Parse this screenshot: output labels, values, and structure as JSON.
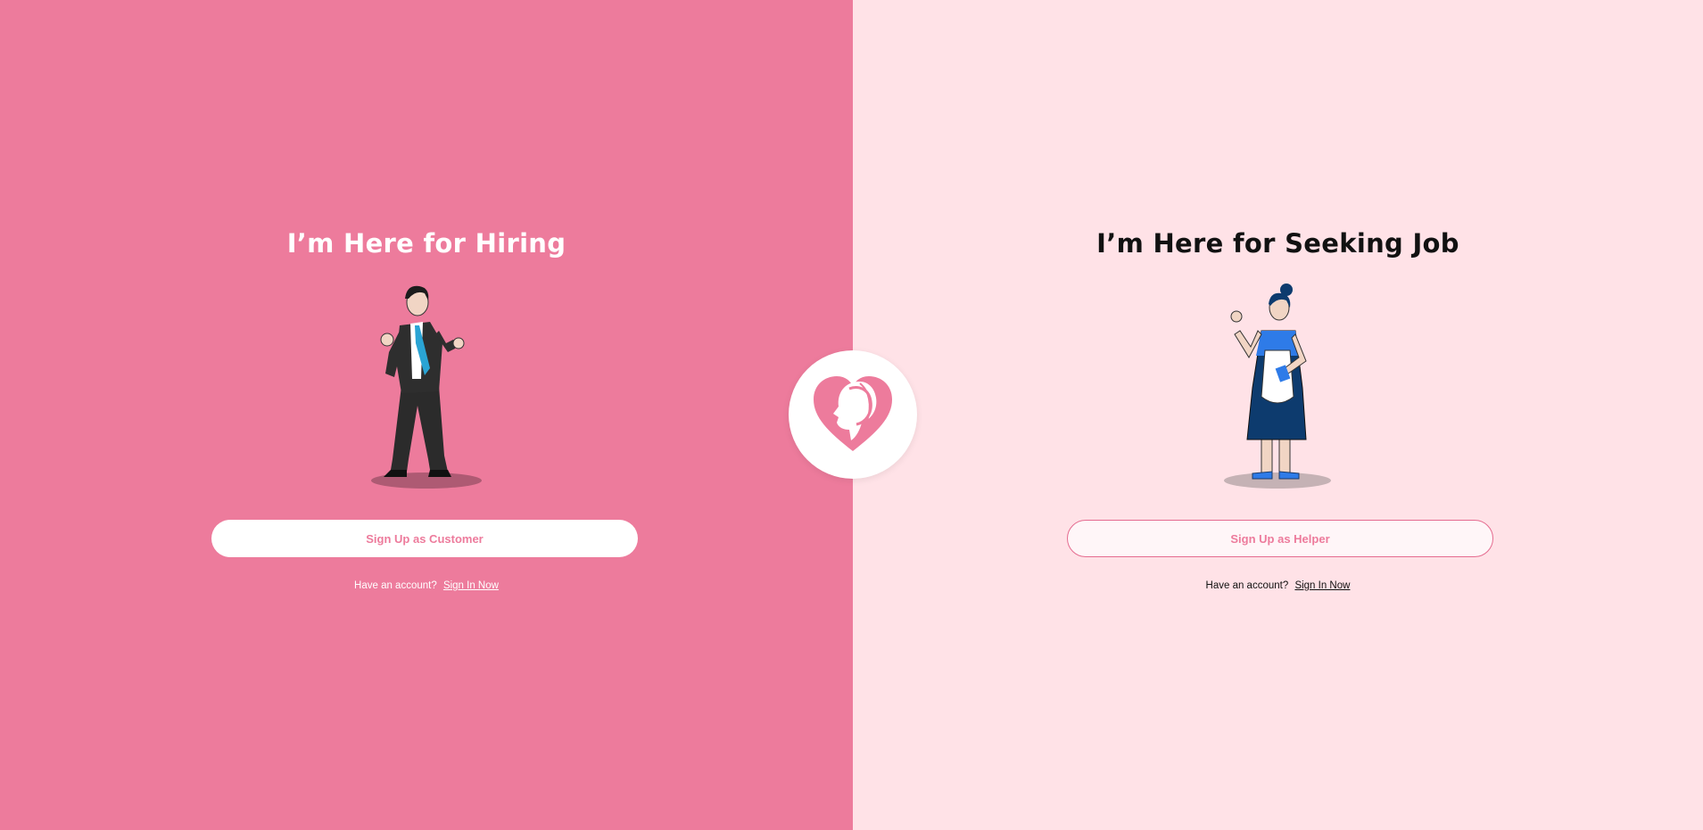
{
  "colors": {
    "left_bg": "#ed7b9c",
    "right_bg": "#ffe2e7",
    "accent": "#ed7b9c"
  },
  "hiring": {
    "title": "I’m Here for Hiring",
    "button_label": "Sign Up as Customer",
    "have_account": "Have an account?",
    "signin_link": "Sign In Now",
    "illustration": "businessman-illustration"
  },
  "seeking": {
    "title": "I’m Here for Seeking Job",
    "button_label": "Sign Up as Helper",
    "have_account": "Have an account?",
    "signin_link": "Sign In Now",
    "illustration": "maid-illustration"
  },
  "logo": {
    "icon": "heart-woman-logo-icon"
  }
}
